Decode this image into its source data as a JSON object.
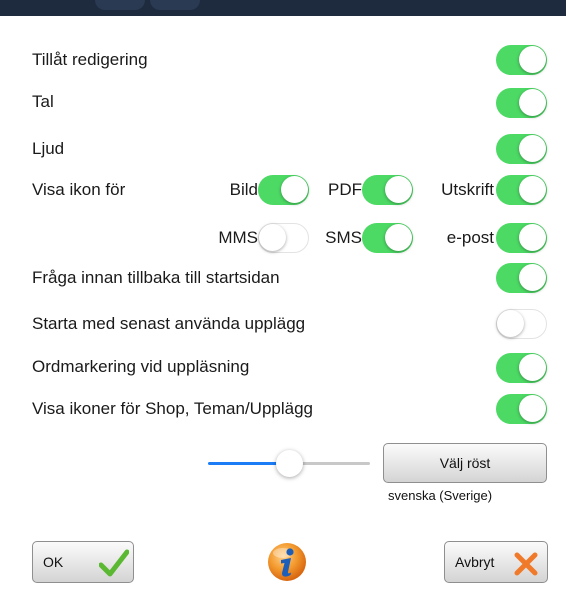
{
  "settings": {
    "allow_editing": {
      "label": "Tillåt redigering",
      "on": true
    },
    "speech": {
      "label": "Tal",
      "on": true
    },
    "sound": {
      "label": "Ljud",
      "on": true
    },
    "show_icons_for": {
      "label": "Visa ikon för",
      "image": {
        "label": "Bild",
        "on": true
      },
      "pdf": {
        "label": "PDF",
        "on": true
      },
      "print": {
        "label": "Utskrift",
        "on": true
      },
      "mms": {
        "label": "MMS",
        "on": false
      },
      "sms": {
        "label": "SMS",
        "on": true
      },
      "email": {
        "label": "e-post",
        "on": true
      }
    },
    "ask_before_home": {
      "label": "Fråga innan tillbaka till startsidan",
      "on": true
    },
    "start_last_layout": {
      "label": "Starta med senast använda upplägg",
      "on": false
    },
    "word_highlight": {
      "label": "Ordmarkering vid uppläsning",
      "on": true
    },
    "show_shop_icons": {
      "label": "Visa ikoner för Shop, Teman/Upplägg",
      "on": true
    }
  },
  "voice": {
    "button_label": "Välj röst",
    "current_voice": "svenska (Sverige)",
    "speech_rate": 0.5
  },
  "footer": {
    "ok_label": "OK",
    "cancel_label": "Avbryt"
  },
  "colors": {
    "toggle_on": "#4cd964",
    "slider_fill": "#1b7cf6",
    "ok_check": "#5bb832",
    "cancel_x": "#f07a2a",
    "info_orange": "#f08a24"
  },
  "icons": {
    "ok": "checkmark-icon",
    "cancel": "x-icon",
    "info": "info-icon"
  }
}
